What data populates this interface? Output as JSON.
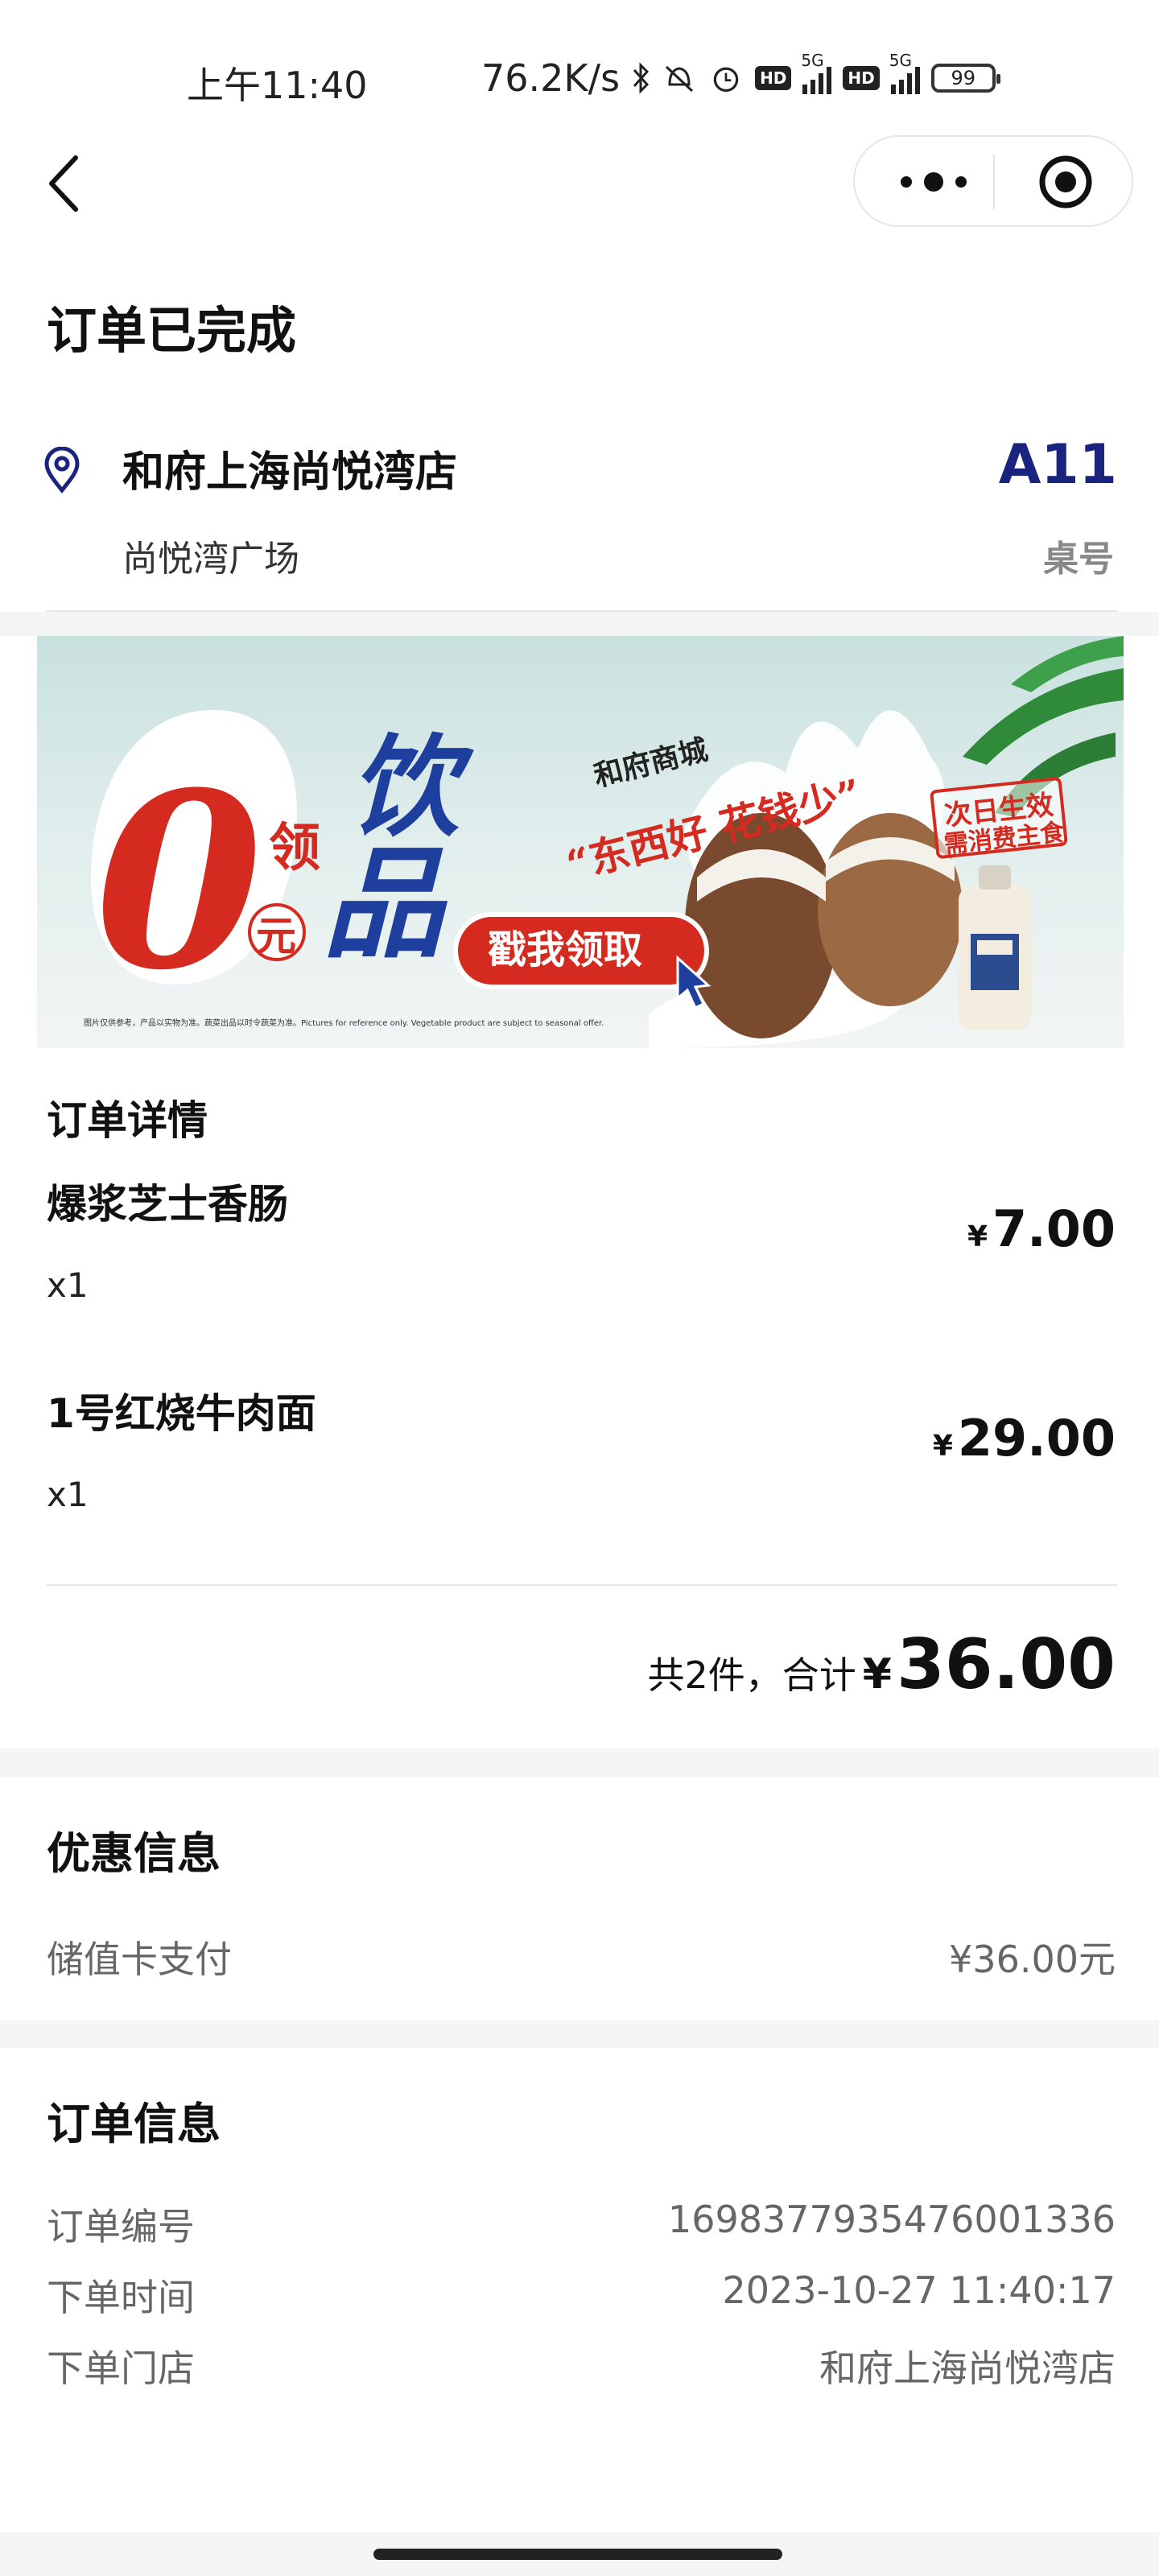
{
  "status_bar": {
    "time": "上午11:40",
    "net_speed": "76.2K/s",
    "hd_badge": "HD",
    "signal_5g": "5G",
    "battery": "99"
  },
  "header": {
    "title": "订单已完成",
    "store_name": "和府上海尚悦湾店",
    "store_address": "尚悦湾广场",
    "table_number": "A11",
    "table_label": "桌号"
  },
  "banner": {
    "big_zero": "0",
    "small_ling": "领",
    "small_yuan": "元",
    "drink_1": "饮",
    "drink_2": "品",
    "mall_name": "和府商城",
    "slogan": "“东西好 花钱少”",
    "stamp_1": "次日生效",
    "stamp_2": "需消费主食",
    "cta": "戳我领取",
    "fineprint": "图片仅供参考，产品以实物为准。蔬菜出品以时令蔬菜为准。Pictures for reference only. Vegetable product are subject to seasonal offer.",
    "accent_red": "#d42a1f",
    "accent_blue": "#1f3f9e"
  },
  "order_detail": {
    "heading": "订单详情",
    "items": [
      {
        "name": "爆浆芝士香肠",
        "qty": "x1",
        "currency": "¥",
        "price": "7.00"
      },
      {
        "name": "1号红烧牛肉面",
        "qty": "x1",
        "currency": "¥",
        "price": "29.00"
      }
    ],
    "total_label": "共2件，合计",
    "total_currency": "¥",
    "total_amount": "36.00"
  },
  "promotion": {
    "title": "优惠信息",
    "payment_label": "储值卡支付",
    "payment_value": "¥36.00元"
  },
  "order_info": {
    "title": "订单信息",
    "rows": [
      {
        "label": "订单编号",
        "value": "1698377935476001336"
      },
      {
        "label": "下单时间",
        "value": "2023-10-27 11:40:17"
      },
      {
        "label": "下单门店",
        "value": "和府上海尚悦湾店"
      }
    ]
  }
}
